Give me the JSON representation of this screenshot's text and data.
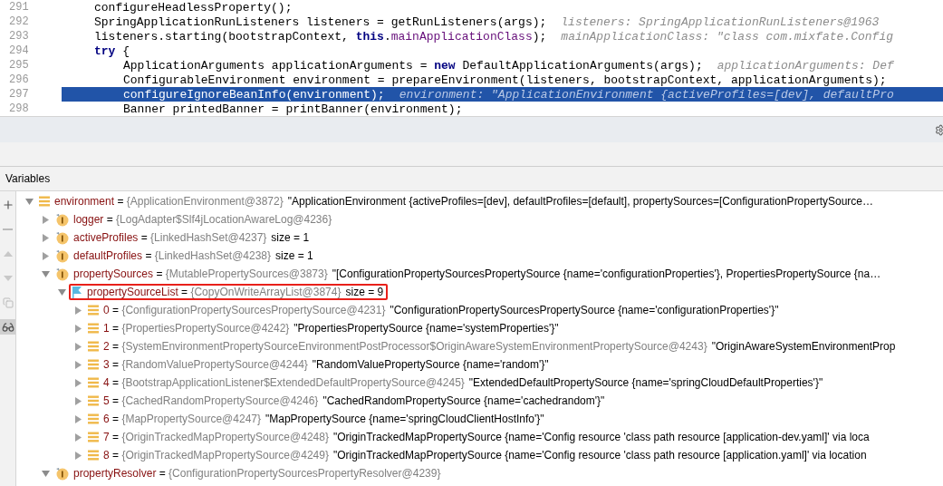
{
  "editor": {
    "lines": [
      {
        "number": "291",
        "selected": false,
        "segments": [
          {
            "kind": "plain",
            "text": "configureHeadlessProperty();"
          }
        ]
      },
      {
        "number": "292",
        "selected": false,
        "segments": [
          {
            "kind": "plain",
            "text": "SpringApplicationRunListeners listeners = getRunListeners(args);"
          }
        ],
        "hint": "listeners: SpringApplicationRunListeners@1963"
      },
      {
        "number": "293",
        "selected": false,
        "segments": [
          {
            "kind": "plain",
            "text": "listeners.starting(bootstrapContext, "
          },
          {
            "kind": "keyword",
            "text": "this"
          },
          {
            "kind": "plain",
            "text": "."
          },
          {
            "kind": "field",
            "text": "mainApplicationClass"
          },
          {
            "kind": "plain",
            "text": ");"
          }
        ],
        "hint": "mainApplicationClass: \"class com.mixfate.Config"
      },
      {
        "number": "294",
        "selected": false,
        "segments": [
          {
            "kind": "keyword",
            "text": "try"
          },
          {
            "kind": "plain",
            "text": " {"
          }
        ],
        "children": [
          {
            "number": "295",
            "selected": false,
            "segments": [
              {
                "kind": "plain",
                "text": "ApplicationArguments applicationArguments = "
              },
              {
                "kind": "keyword",
                "text": "new"
              },
              {
                "kind": "plain",
                "text": " DefaultApplicationArguments(args);"
              }
            ],
            "hint": "applicationArguments: Def"
          },
          {
            "number": "296",
            "selected": false,
            "segments": [
              {
                "kind": "plain",
                "text": "ConfigurableEnvironment environment = prepareEnvironment(listeners, bootstrapContext, applicationArguments);"
              }
            ]
          },
          {
            "number": "297",
            "selected": true,
            "segments": [
              {
                "kind": "plain",
                "text": "configureIgnoreBeanInfo(environment);"
              }
            ],
            "hint": "environment: \"ApplicationEnvironment {activeProfiles=[dev], defaultPro"
          },
          {
            "number": "298",
            "selected": false,
            "segments": [
              {
                "kind": "plain",
                "text": "Banner printedBanner = printBanner(environment);"
              }
            ]
          }
        ]
      }
    ]
  },
  "panel": {
    "title": "Variables"
  },
  "side_toolbar": {
    "view_toggle_on": true
  },
  "variables": [
    {
      "kind": "list",
      "name": "environment",
      "operator": "=",
      "type": "{ApplicationEnvironment@3872}",
      "value": "\"ApplicationEnvironment {activeProfiles=[dev], defaultProfiles=[default], propertySources=[ConfigurationPropertySource…",
      "expanded": true,
      "children": [
        {
          "kind": "field",
          "name": "logger",
          "operator": "=",
          "type": "{LogAdapter$Slf4jLocationAwareLog@4236}",
          "expanded": false
        },
        {
          "kind": "field",
          "name": "activeProfiles",
          "operator": "=",
          "type": "{LinkedHashSet@4237}",
          "size": "size = 1",
          "expanded": false
        },
        {
          "kind": "field",
          "name": "defaultProfiles",
          "operator": "=",
          "type": "{LinkedHashSet@4238}",
          "size": "size = 1",
          "expanded": false
        },
        {
          "kind": "field",
          "name": "propertySources",
          "operator": "=",
          "type": "{MutablePropertySources@3873}",
          "value": "\"[ConfigurationPropertySourcesPropertySource {name='configurationProperties'}, PropertiesPropertySource {na…",
          "expanded": true,
          "children": [
            {
              "kind": "flag",
              "name": "propertySourceList",
              "operator": "=",
              "type": "{CopyOnWriteArrayList@3874}",
              "size": "size = 9",
              "outlined": true,
              "expanded": true,
              "children": [
                {
                  "kind": "list",
                  "name": "0",
                  "operator": "=",
                  "type": "{ConfigurationPropertySourcesPropertySource@4231}",
                  "value": "\"ConfigurationPropertySourcesPropertySource {name='configurationProperties'}\"",
                  "expanded": false
                },
                {
                  "kind": "list",
                  "name": "1",
                  "operator": "=",
                  "type": "{PropertiesPropertySource@4242}",
                  "value": "\"PropertiesPropertySource {name='systemProperties'}\"",
                  "expanded": false
                },
                {
                  "kind": "list",
                  "name": "2",
                  "operator": "=",
                  "type": "{SystemEnvironmentPropertySourceEnvironmentPostProcessor$OriginAwareSystemEnvironmentPropertySource@4243}",
                  "value": "\"OriginAwareSystemEnvironmentProp",
                  "expanded": false
                },
                {
                  "kind": "list",
                  "name": "3",
                  "operator": "=",
                  "type": "{RandomValuePropertySource@4244}",
                  "value": "\"RandomValuePropertySource {name='random'}\"",
                  "expanded": false
                },
                {
                  "kind": "list",
                  "name": "4",
                  "operator": "=",
                  "type": "{BootstrapApplicationListener$ExtendedDefaultPropertySource@4245}",
                  "value": "\"ExtendedDefaultPropertySource {name='springCloudDefaultProperties'}\"",
                  "expanded": false
                },
                {
                  "kind": "list",
                  "name": "5",
                  "operator": "=",
                  "type": "{CachedRandomPropertySource@4246}",
                  "value": "\"CachedRandomPropertySource {name='cachedrandom'}\"",
                  "expanded": false
                },
                {
                  "kind": "list",
                  "name": "6",
                  "operator": "=",
                  "type": "{MapPropertySource@4247}",
                  "value": "\"MapPropertySource {name='springCloudClientHostInfo'}\"",
                  "expanded": false
                },
                {
                  "kind": "list",
                  "name": "7",
                  "operator": "=",
                  "type": "{OriginTrackedMapPropertySource@4248}",
                  "value": "\"OriginTrackedMapPropertySource {name='Config resource 'class path resource [application-dev.yaml]' via loca",
                  "expanded": false
                },
                {
                  "kind": "list",
                  "name": "8",
                  "operator": "=",
                  "type": "{OriginTrackedMapPropertySource@4249}",
                  "value": "\"OriginTrackedMapPropertySource {name='Config resource 'class path resource [application.yaml]' via location",
                  "expanded": false
                }
              ]
            }
          ]
        },
        {
          "kind": "field",
          "name": "propertyResolver",
          "operator": "=",
          "type": "{ConfigurationPropertySourcesPropertyResolver@4239}",
          "expanded": true
        }
      ]
    }
  ]
}
